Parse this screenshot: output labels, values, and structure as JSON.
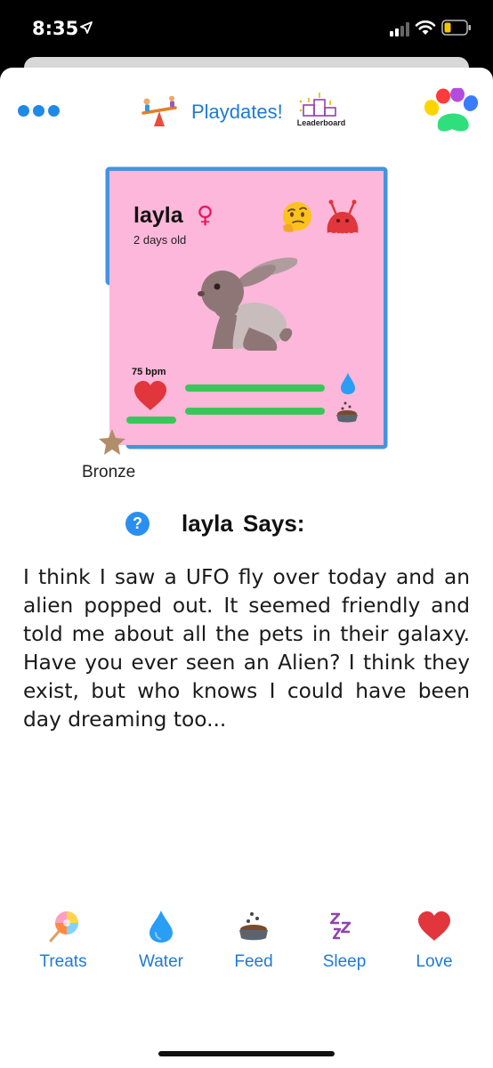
{
  "status": {
    "time": "8:35"
  },
  "header": {
    "title": "Playdates!",
    "leaderboard_label": "Leaderboard"
  },
  "pet": {
    "name": "layla",
    "age": "2 days old",
    "heart_rate": "75 bpm",
    "rank": "Bronze",
    "stats": {
      "love": 1.0,
      "water": 1.0,
      "food": 1.0
    }
  },
  "speech": {
    "title": "layla Says:",
    "message": "I think I saw a UFO fly over today and an alien popped out. It seemed friendly and told me about all the pets in their galaxy. Have you ever seen an Alien? I think they exist, but who knows I could have been day dreaming too..."
  },
  "actions": [
    {
      "label": "Treats",
      "icon": "lollipop-icon"
    },
    {
      "label": "Water",
      "icon": "water-drop-icon"
    },
    {
      "label": "Feed",
      "icon": "food-bowl-icon"
    },
    {
      "label": "Sleep",
      "icon": "sleep-zzz-icon"
    },
    {
      "label": "Love",
      "icon": "heart-icon"
    }
  ],
  "colors": {
    "accent": "#1e7ad6",
    "card_background": "#fdb7da",
    "card_border": "#4593e0",
    "stat_bar": "#3ac65a"
  }
}
